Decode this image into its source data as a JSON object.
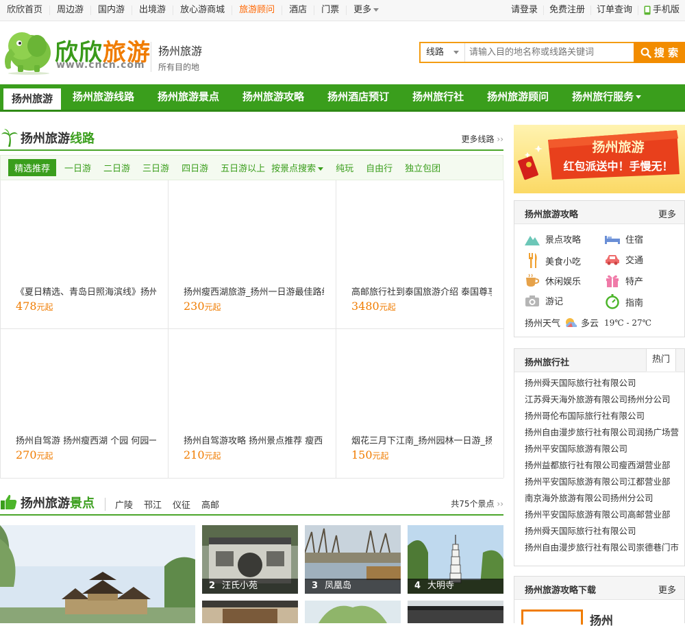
{
  "topbar": {
    "left_items": [
      "欣欣首页",
      "周边游",
      "国内游",
      "出境游",
      "放心游商城",
      "旅游顾问",
      "酒店",
      "门票",
      "更多"
    ],
    "right_items": [
      "请登录",
      "免费注册",
      "订单查询",
      "手机版"
    ]
  },
  "header": {
    "logo_text_a": "欣欣",
    "logo_text_b": "旅游",
    "logo_url": "www.cncn.com",
    "city_title": "扬州旅游",
    "city_sub": "所有目的地",
    "search_type": "线路",
    "search_placeholder": "请输入目的地名称或线路关键词",
    "search_button": "搜 索"
  },
  "nav": {
    "items": [
      "扬州旅游",
      "扬州旅游线路",
      "扬州旅游景点",
      "扬州旅游攻略",
      "扬州酒店预订",
      "扬州旅行社",
      "扬州旅游顾问",
      "扬州旅行服务"
    ]
  },
  "routes": {
    "title_a": "扬州旅游",
    "title_b": "线路",
    "more": "更多线路",
    "tabs": [
      "精选推荐",
      "一日游",
      "二日游",
      "三日游",
      "四日游",
      "五日游以上",
      "按景点搜索",
      "纯玩",
      "自由行",
      "独立包团"
    ],
    "price_unit": "元起",
    "items": [
      {
        "name": "《夏日精选、青岛日照海滨线》扬州",
        "price": "478"
      },
      {
        "name": "扬州瘦西湖旅游_扬州一日游最佳路线",
        "price": "230"
      },
      {
        "name": "高邮旅行社到泰国旅游介绍 泰国尊享",
        "price": "3480"
      },
      {
        "name": "扬州自驾游 扬州瘦西湖 个园 何园一",
        "price": "270"
      },
      {
        "name": "扬州自驾游攻略 扬州景点推荐 瘦西",
        "price": "210"
      },
      {
        "name": "烟花三月下江南_扬州园林一日游_扬",
        "price": "150"
      }
    ]
  },
  "scenery": {
    "title_a": "扬州旅游",
    "title_b": "景点",
    "tags": [
      "广陵",
      "邗江",
      "仪征",
      "高邮"
    ],
    "more": "共75个景点",
    "photos": [
      {
        "num": "2",
        "name": "汪氏小苑"
      },
      {
        "num": "3",
        "name": "凤凰岛"
      },
      {
        "num": "4",
        "name": "大明寺"
      }
    ]
  },
  "banner": {
    "line1": "扬州旅游",
    "line2": "红包派送中！手慢无！"
  },
  "guide": {
    "title": "扬州旅游攻略",
    "more": "更多",
    "items": [
      "景点攻略",
      "住宿",
      "美食小吃",
      "交通",
      "休闲娱乐",
      "特产",
      "游记",
      "指南"
    ],
    "weather_label": "扬州天气",
    "weather_cond": "多云",
    "weather_temp": "19℃ - 27℃"
  },
  "agency": {
    "title": "扬州旅行社",
    "hot_tab": "热门",
    "items": [
      "扬州舜天国际旅行社有限公司",
      "江苏舜天海外旅游有限公司扬州分公司",
      "扬州哥伦布国际旅行社有限公司",
      "扬州自由漫步旅行社有限公司润扬广场营",
      "扬州平安国际旅游有限公司",
      "扬州益都旅行社有限公司瘦西湖营业部",
      "扬州平安国际旅游有限公司江都营业部",
      "南京海外旅游有限公司扬州分公司",
      "扬州平安国际旅游有限公司高邮营业部",
      "扬州舜天国际旅行社有限公司",
      "扬州自由漫步旅行社有限公司崇德巷门市"
    ]
  },
  "download": {
    "title": "扬州旅游攻略下载",
    "more": "更多",
    "book_title": "扬州"
  },
  "colors": {
    "brand_green": "#3a9e1c",
    "accent_orange": "#f28c00",
    "price_orange": "#f07c00"
  }
}
